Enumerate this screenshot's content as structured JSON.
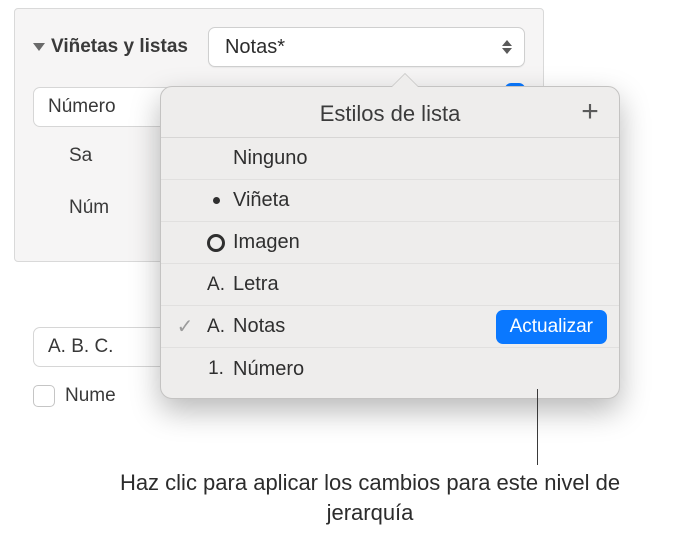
{
  "section": {
    "title": "Viñetas y listas"
  },
  "styleDropdown": {
    "selected": "Notas*"
  },
  "background": {
    "typeControl": "Número",
    "indentLabel": "Sa",
    "numberLabel": "Núm",
    "formatControl": "A. B. C.",
    "checkboxLabel": "Nume"
  },
  "popover": {
    "title": "Estilos de lista",
    "addGlyph": "+",
    "items": [
      {
        "checked": false,
        "prefixType": "none",
        "prefix": "",
        "label": "Ninguno"
      },
      {
        "checked": false,
        "prefixType": "dot",
        "prefix": "",
        "label": "Viñeta"
      },
      {
        "checked": false,
        "prefixType": "ring",
        "prefix": "",
        "label": "Imagen"
      },
      {
        "checked": false,
        "prefixType": "text",
        "prefix": "A.",
        "label": "Letra"
      },
      {
        "checked": true,
        "prefixType": "text",
        "prefix": "A.",
        "label": "Notas",
        "updateLabel": "Actualizar"
      },
      {
        "checked": false,
        "prefixType": "text",
        "prefix": "1.",
        "label": "Número"
      }
    ],
    "checkGlyph": "✓"
  },
  "callout": {
    "text": "Haz clic para aplicar los cambios para este nivel de jerarquía"
  }
}
